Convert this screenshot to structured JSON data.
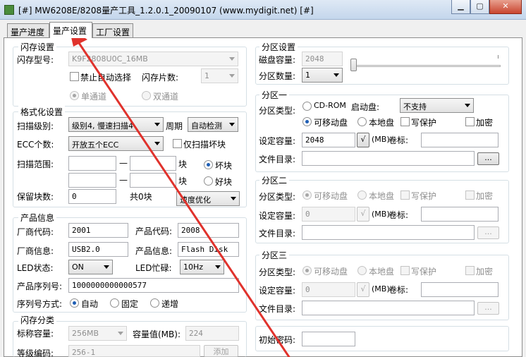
{
  "window": {
    "title": "[#] MW6208E/8208量产工具_1.2.0.1_20090107 (www.mydigit.net) [#]"
  },
  "tabs": [
    "量产进度",
    "量产设置",
    "工厂设置"
  ],
  "flash": {
    "title": "闪存设置",
    "model_label": "闪存型号:",
    "model_value": "K9F2808U0C_16MB",
    "auto_select": "禁止自动选择",
    "chip_count_label": "闪存片数:",
    "chip_count_value": "1",
    "single_channel": "单通道",
    "dual_channel": "双通道"
  },
  "format": {
    "title": "格式化设置",
    "scan_level_label": "扫描级别:",
    "scan_level_value": "级别4, 慢速扫描4",
    "cycle_label": "周期",
    "cycle_value": "自动检测",
    "ecc_label": "ECC个数:",
    "ecc_value": "开放五个ECC",
    "scan_bad_only": "仅扫描坏块",
    "scan_range_label": "扫描范围:",
    "dash": "—",
    "block_unit": "块",
    "bad_block": "坏块",
    "good_block": "好块",
    "reserved_label": "保留块数:",
    "reserved_value": "0",
    "total_blocks": "共0块",
    "speed_value": "速度优化"
  },
  "product": {
    "title": "产品信息",
    "vendor_code_label": "厂商代码:",
    "vendor_code_value": "2001",
    "product_code_label": "产品代码:",
    "product_code_value": "2008",
    "vendor_info_label": "厂商信息:",
    "vendor_info_value": "USB2.0",
    "product_info_label": "产品信息:",
    "product_info_value": "Flash Disk",
    "led_state_label": "LED状态:",
    "led_state_value": "ON",
    "led_busy_label": "LED忙碌:",
    "led_busy_value": "10Hz",
    "serial_label": "产品序列号:",
    "serial_value": "1000000000000577",
    "serial_mode_label": "序列号方式:",
    "serial_auto": "自动",
    "serial_fixed": "固定",
    "serial_inc": "递增"
  },
  "classify": {
    "title": "闪存分类",
    "nominal_label": "标称容量:",
    "nominal_value": "256MB",
    "capacity_label": "容量值(MB):",
    "capacity_value": "224",
    "grade_label": "等级编码:",
    "grade_value": "256-1",
    "add_button": "添加"
  },
  "partition": {
    "title": "分区设置",
    "disk_cap_label": "磁盘容量:",
    "disk_cap_value": "2048",
    "count_label": "分区数量:",
    "count_value": "1",
    "slider_level": 0
  },
  "p1": {
    "title": "分区一",
    "type_label": "分区类型:",
    "cdrom": "CD-ROM",
    "boot_label": "启动盘:",
    "boot_value": "不支持",
    "removable": "可移动盘",
    "local": "本地盘",
    "write_protect": "写保护",
    "encrypt": "加密",
    "cap_label": "设定容量:",
    "cap_value": "2048",
    "unit_label": "(MB)",
    "vol_label": "卷标:",
    "dir_label": "文件目录:",
    "browse": "..."
  },
  "p2": {
    "title": "分区二",
    "type_label": "分区类型:",
    "removable": "可移动盘",
    "local": "本地盘",
    "write_protect": "写保护",
    "encrypt": "加密",
    "cap_label": "设定容量:",
    "cap_value": "0",
    "unit_label": "(MB)",
    "vol_label": "卷标:",
    "dir_label": "文件目录:",
    "browse": "..."
  },
  "p3": {
    "title": "分区三",
    "type_label": "分区类型:",
    "removable": "可移动盘",
    "local": "本地盘",
    "write_protect": "写保护",
    "encrypt": "加密",
    "cap_label": "设定容量:",
    "cap_value": "0",
    "unit_label": "(MB)",
    "vol_label": "卷标:",
    "dir_label": "文件目录:",
    "browse": "..."
  },
  "password": {
    "label": "初始密码:"
  },
  "check_glyph": "√",
  "colors": {
    "annotation_arrow": "#e0322c",
    "radio_dot": "#1f5fb5"
  }
}
